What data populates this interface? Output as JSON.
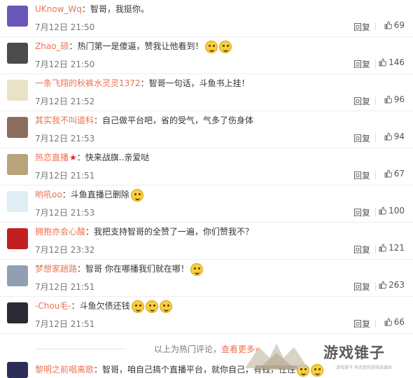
{
  "comments": [
    {
      "user": "UKnow_Wq",
      "text": "智哥，我挺你。",
      "emojis": 0,
      "time": "7月12日 21:50",
      "reply": "回复",
      "likes": "69",
      "avatar": "#6a56b8"
    },
    {
      "user": "Zhao_硕",
      "text": "热门第一是傻逼，赞我让他看到！",
      "emojis": 2,
      "time": "7月12日 21:50",
      "reply": "回复",
      "likes": "146",
      "avatar": "#4b4b4b"
    },
    {
      "user": "一条飞翔的秋裤水灵灵1372",
      "text": "智哥一句话，斗鱼书上挂！",
      "emojis": 0,
      "time": "7月12日 21:52",
      "reply": "回复",
      "likes": "96",
      "avatar": "#e9e2c4"
    },
    {
      "user": "其实我不叫道科",
      "text": "自己做平台吧，省的受气，气多了伤身体",
      "emojis": 0,
      "time": "7月12日 21:53",
      "reply": "回复",
      "likes": "94",
      "avatar": "#8a6d5a"
    },
    {
      "user": "热恋直播",
      "text": "快来战旗..亲爱哒",
      "emojis": 0,
      "time": "7月12日 21:51",
      "reply": "回复",
      "likes": "67",
      "avatar": "#b9a37a",
      "star": "★"
    },
    {
      "user": "哟吼oo",
      "text": "斗鱼直播已删除",
      "emojis": 1,
      "time": "7月12日 21:53",
      "reply": "回复",
      "likes": "100",
      "avatar": "#dfeef5"
    },
    {
      "user": "拥抱亦会心酸",
      "text": "我把支持智哥的全赞了一遍，你们赞我不？",
      "emojis": 0,
      "time": "7月12日 23:32",
      "reply": "回复",
      "likes": "121",
      "avatar": "#c22020"
    },
    {
      "user": "梦想家趟路",
      "text": "智哥 你在哪播我们就在哪！",
      "emojis": 1,
      "time": "7月12日 21:51",
      "reply": "回复",
      "likes": "263",
      "avatar": "#8fa0b2"
    },
    {
      "user": "-Chou毛-",
      "text": "斗鱼欠债还钱",
      "emojis": 3,
      "time": "7月12日 21:51",
      "reply": "回复",
      "likes": "66",
      "avatar": "#2a2a33"
    }
  ],
  "more": {
    "prefix": "以上为热门评论，",
    "link": "查看更多",
    "suffix": "»"
  },
  "last": {
    "user": "黎明之前唱离歌",
    "text": "智哥，咱自己搞个直播平台，就你自己，有钱，任性",
    "emojis": 2,
    "avatar": "#2d2d5a"
  },
  "watermark": {
    "title": "游戏锥子",
    "subtitle": "游戏锥子 有态度的游戏自媒体"
  }
}
